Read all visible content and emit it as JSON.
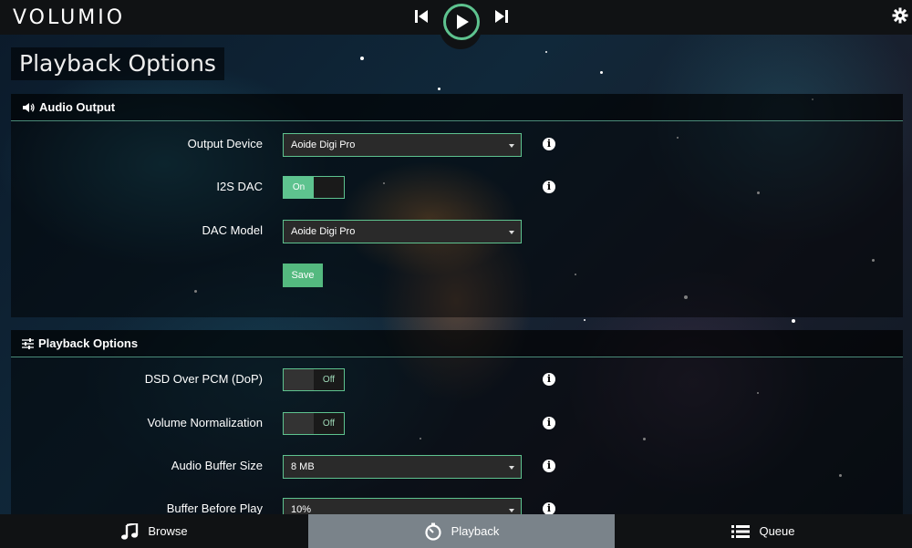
{
  "app": {
    "logo": "VOLUMIO"
  },
  "page": {
    "title": "Playback Options"
  },
  "audio_output": {
    "heading": "Audio Output",
    "output_device": {
      "label": "Output Device",
      "value": "Aoide Digi Pro"
    },
    "i2s_dac": {
      "label": "I2S DAC",
      "state": "On"
    },
    "dac_model": {
      "label": "DAC Model",
      "value": "Aoide Digi Pro"
    },
    "save_label": "Save"
  },
  "playback_options": {
    "heading": "Playback Options",
    "dsd_over_pcm": {
      "label": "DSD Over PCM (DoP)",
      "state": "Off"
    },
    "volume_normalization": {
      "label": "Volume Normalization",
      "state": "Off"
    },
    "audio_buffer_size": {
      "label": "Audio Buffer Size",
      "value": "8 MB"
    },
    "buffer_before_play": {
      "label": "Buffer Before Play",
      "value": "10%"
    }
  },
  "nav": {
    "browse": "Browse",
    "playback": "Playback",
    "queue": "Queue"
  },
  "colors": {
    "accent": "#5ec38f",
    "topbar": "#101214",
    "active_tab": "#7a838a"
  }
}
